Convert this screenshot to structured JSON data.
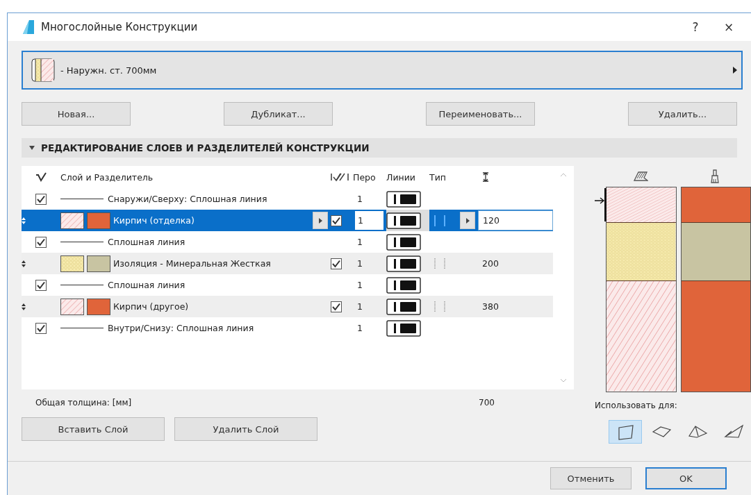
{
  "window": {
    "title": "Многослойные Конструкции",
    "help": "?",
    "close": "×"
  },
  "composite": {
    "name": "- Наружн. ст. 700мм"
  },
  "actions": [
    "Новая...",
    "Дубликат...",
    "Переименовать...",
    "Удалить..."
  ],
  "section": {
    "title": "РЕДАКТИРОВАНИЕ СЛОЕВ И РАЗДЕЛИТЕЛЕЙ КОНСТРУКЦИИ",
    "expanded": true
  },
  "table": {
    "columns": [
      "Слой и Разделитель",
      "Перо",
      "Линии",
      "Тип"
    ],
    "rows": [
      {
        "kind": "line",
        "checked": true,
        "label": "Снаружи/Сверху: Сплошная линия",
        "pen": "1"
      },
      {
        "kind": "layer",
        "selected": true,
        "hatch": {
          "kind": "brick"
        },
        "color": "#e0643a",
        "label": "Кирпич (отделка)",
        "visible": true,
        "pen": "1",
        "thickness": "120"
      },
      {
        "kind": "line",
        "checked": true,
        "label": "Сплошная линия",
        "pen": "1"
      },
      {
        "kind": "layer",
        "selected": false,
        "hatch": {
          "kind": "insulation"
        },
        "color": "#c8c4a2",
        "label": "Изоляция - Минеральная Жесткая",
        "visible": true,
        "pen": "1",
        "thickness": "200"
      },
      {
        "kind": "line",
        "checked": true,
        "label": "Сплошная линия",
        "pen": "1"
      },
      {
        "kind": "layer",
        "selected": false,
        "hatch": {
          "kind": "brick"
        },
        "color": "#e0643a",
        "label": "Кирпич (другое)",
        "visible": true,
        "pen": "1",
        "thickness": "380"
      },
      {
        "kind": "line",
        "checked": true,
        "label": "Внутри/Снизу: Сплошная линия",
        "pen": "1"
      }
    ],
    "total_label": "Общая толщина: [мм]",
    "total": "700"
  },
  "layer_buttons": [
    "Вставить Слой",
    "Удалить Слой"
  ],
  "use_for": {
    "label": "Использовать для:",
    "options": [
      {
        "selected": true
      },
      {
        "selected": false
      },
      {
        "selected": false
      },
      {
        "selected": false
      }
    ]
  },
  "dialog_buttons": [
    {
      "label": "Отменить",
      "default": false
    },
    {
      "label": "OK",
      "default": true
    }
  ]
}
